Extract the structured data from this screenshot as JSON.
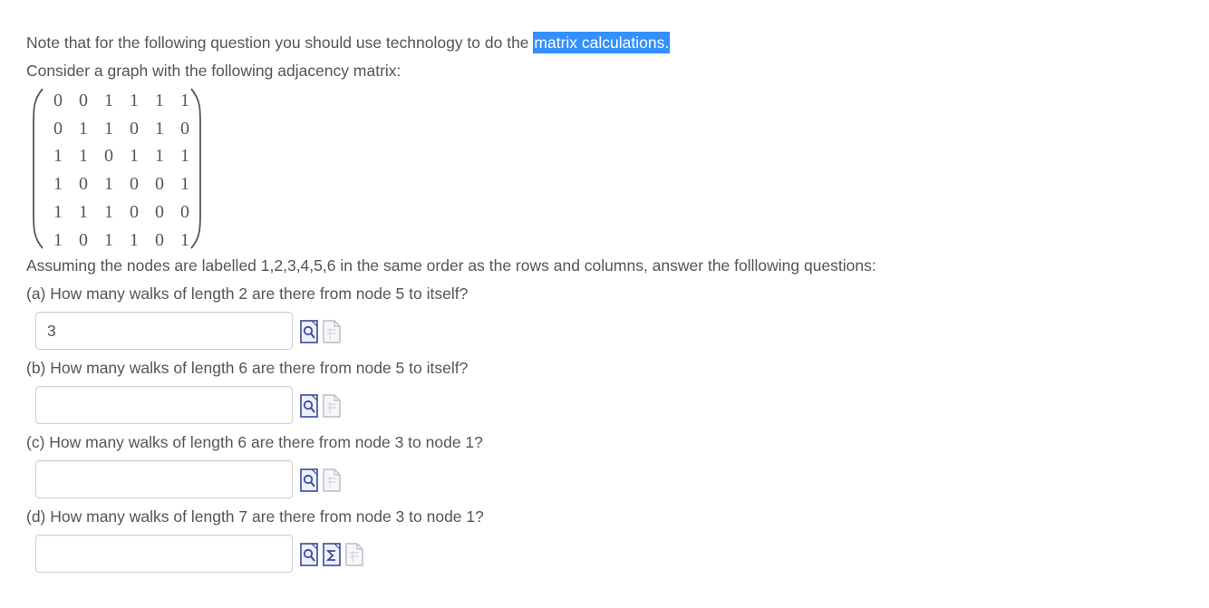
{
  "question": {
    "intro_text": "Note that for the following question you should use technology to do the ",
    "intro_highlight": "matrix calculations.",
    "consider_text": "Consider a graph with the following adjacency matrix:",
    "matrix": [
      [
        "0",
        "0",
        "1",
        "1",
        "1",
        "1"
      ],
      [
        "0",
        "1",
        "1",
        "0",
        "1",
        "0"
      ],
      [
        "1",
        "1",
        "0",
        "1",
        "1",
        "1"
      ],
      [
        "1",
        "0",
        "1",
        "0",
        "0",
        "1"
      ],
      [
        "1",
        "1",
        "1",
        "0",
        "0",
        "0"
      ],
      [
        "1",
        "0",
        "1",
        "1",
        "0",
        "1"
      ]
    ],
    "assuming_text": "Assuming the nodes are labelled 1,2,3,4,5,6 in the same order as the rows and columns, answer the folllowing questions:"
  },
  "parts": [
    {
      "label": "(a) How many walks of length 2 are there from node 5 to itself?",
      "value": "3",
      "icons": [
        "preview-icon",
        "sheet-icon"
      ]
    },
    {
      "label": "(b) How many walks of length 6 are there from node 5 to itself?",
      "value": "",
      "icons": [
        "preview-icon",
        "sheet-icon"
      ]
    },
    {
      "label": "(c) How many walks of length 6 are there from node 3 to node 1?",
      "value": "",
      "icons": [
        "preview-icon",
        "sheet-icon"
      ]
    },
    {
      "label": "(d) How many walks of length 7 are there from node 3 to node 1?",
      "value": "",
      "icons": [
        "preview-icon",
        "sum-icon",
        "sheet-icon"
      ]
    }
  ],
  "colors": {
    "text": "#555555",
    "highlight_bg": "#3390ff",
    "highlight_text": "#ffffff",
    "input_border": "#cfcfcf",
    "icon_blue": "#3a4a9c",
    "icon_grey": "#b8bcc8"
  }
}
